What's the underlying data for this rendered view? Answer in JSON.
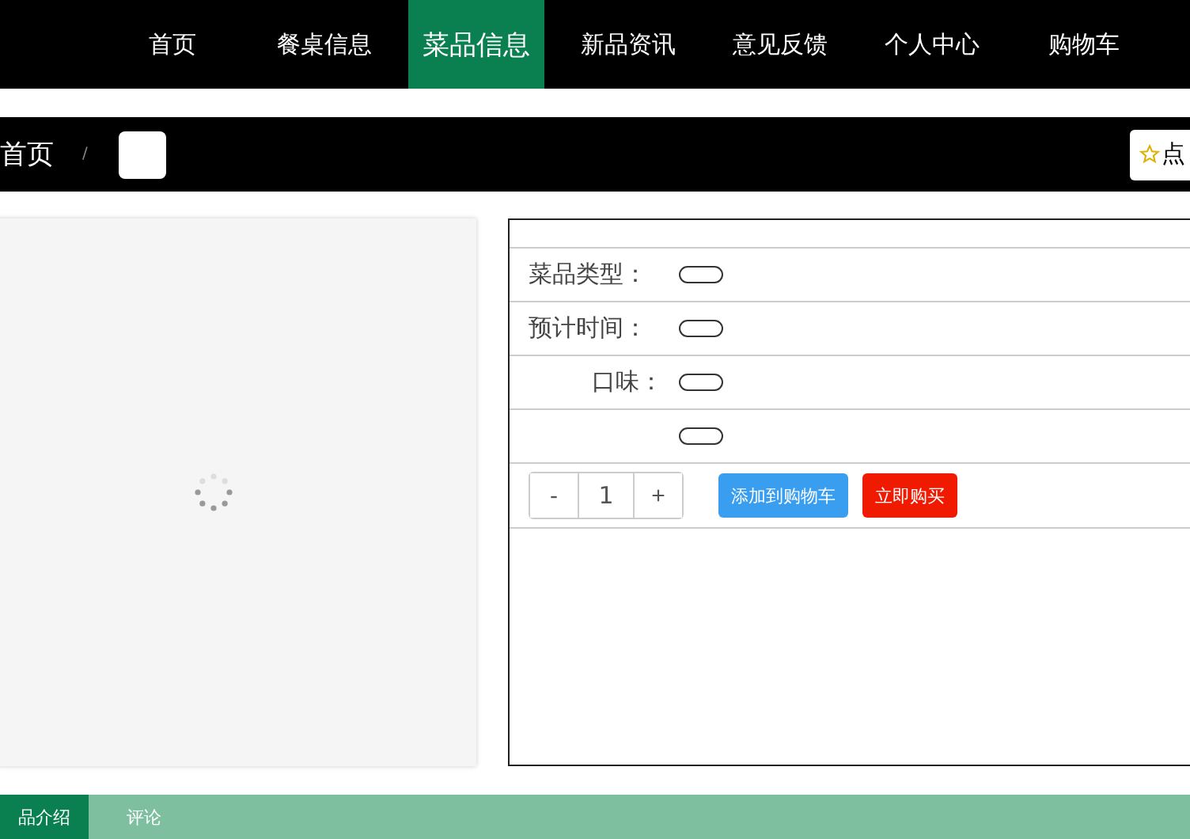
{
  "nav": {
    "items": [
      {
        "label": "首页",
        "selected": false
      },
      {
        "label": "餐桌信息",
        "selected": false
      },
      {
        "label": "菜品信息",
        "selected": true
      },
      {
        "label": "新品资讯",
        "selected": false
      },
      {
        "label": "意见反馈",
        "selected": false
      },
      {
        "label": "个人中心",
        "selected": false
      },
      {
        "label": "购物车",
        "selected": false
      }
    ]
  },
  "breadcrumb": {
    "home": "首页",
    "separator": "/",
    "favorite": "点"
  },
  "details": {
    "rows": [
      {
        "label": "菜品类型："
      },
      {
        "label": "预计时间："
      },
      {
        "label": "口味："
      },
      {
        "label": ""
      }
    ]
  },
  "quantity": {
    "minus": "-",
    "value": "1",
    "plus": "+"
  },
  "buttons": [
    {
      "label": "添加到购物车",
      "kind": "cart"
    },
    {
      "label": "立即购买",
      "kind": "buy"
    }
  ],
  "bottom_tabs": [
    {
      "label": "品介绍",
      "selected": true
    },
    {
      "label": "评论",
      "selected": false
    }
  ]
}
